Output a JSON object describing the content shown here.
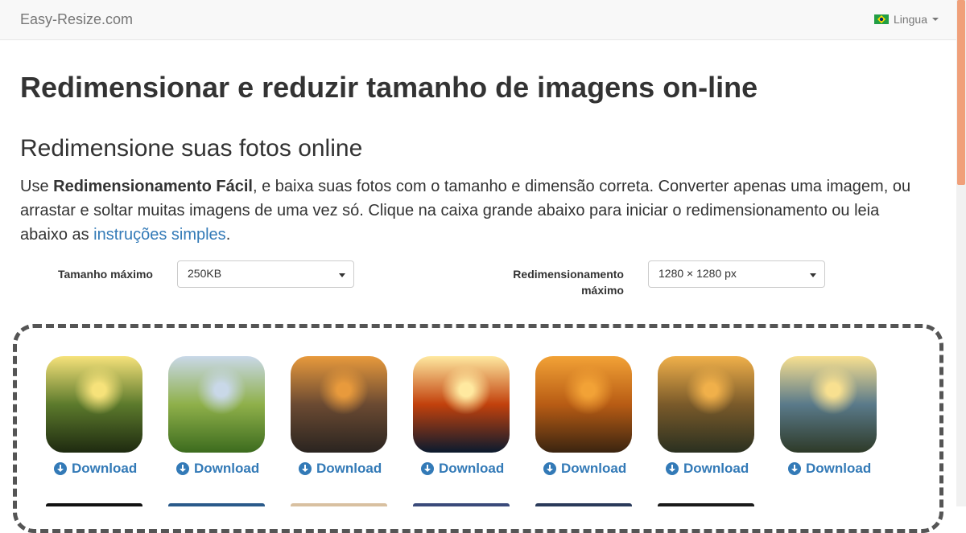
{
  "navbar": {
    "brand": "Easy-Resize.com",
    "language_label": "Lingua"
  },
  "heading": "Redimensionar e reduzir tamanho de imagens on-line",
  "subheading": "Redimensione suas fotos online",
  "intro": {
    "prefix": "Use ",
    "bold": "Redimensionamento Fácil",
    "middle": ", e baixa suas fotos com o tamanho e dimensão correta. Converter apenas uma imagem, ou arrastar e soltar muitas imagens de uma vez só. Clique na caixa grande abaixo para iniciar o redimensionamento ou leia abaixo as ",
    "link": "instruções simples",
    "suffix": "."
  },
  "options": {
    "max_size_label": "Tamanho máximo",
    "max_size_value": "250KB",
    "max_resize_label_line1": "Redimensionamento",
    "max_resize_label_line2": "máximo",
    "max_resize_value": "1280 × 1280 px"
  },
  "gallery": {
    "download_label": "Download",
    "images": [
      {
        "name": "forest-sunrise",
        "colors": [
          "#f6e27a",
          "#5c7a2c",
          "#1e2a10"
        ]
      },
      {
        "name": "green-hills",
        "colors": [
          "#c9d8e8",
          "#8fb04a",
          "#3c6b1e"
        ]
      },
      {
        "name": "wave-splash",
        "colors": [
          "#e89a3c",
          "#6b4a32",
          "#2a2420"
        ]
      },
      {
        "name": "earth-sunrise",
        "colors": [
          "#ffe9a0",
          "#c2410c",
          "#0a1a2e"
        ]
      },
      {
        "name": "palm-beach-sunset",
        "colors": [
          "#f2a236",
          "#b85c14",
          "#3a2410"
        ]
      },
      {
        "name": "village-sunset",
        "colors": [
          "#f0b04a",
          "#7a5a2a",
          "#2a3020"
        ]
      },
      {
        "name": "mountain-lake",
        "colors": [
          "#f8e090",
          "#5a7a8a",
          "#2e3a28"
        ]
      }
    ],
    "second_row_colors": [
      "#111111",
      "#2a5a8a",
      "#d8c0a0",
      "#3a4a7a",
      "#2a3a5a",
      "#1a1a1a"
    ]
  }
}
